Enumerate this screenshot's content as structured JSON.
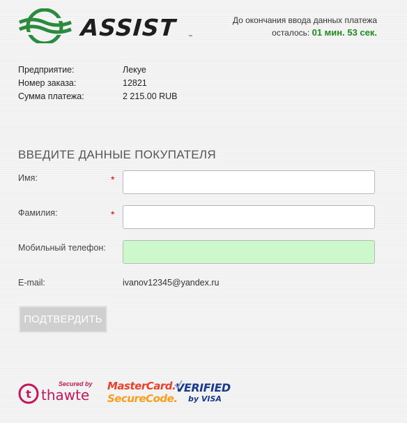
{
  "header": {
    "brand_name": "ASSIST",
    "trademark": "™",
    "timer_line1": "До окончания ввода данных платежа",
    "timer_prefix": "осталось:",
    "timer_value": "01 мин. 53 сек."
  },
  "order_info": [
    {
      "label": "Предприятие:",
      "value": "Лекуе"
    },
    {
      "label": "Номер заказа:",
      "value": "12821"
    },
    {
      "label": "Сумма платежа:",
      "value": "2 215.00 RUB"
    }
  ],
  "form": {
    "title": "ВВЕДИТЕ ДАННЫЕ ПОКУПАТЕЛЯ",
    "required_mark": "*",
    "fields": {
      "first_name": {
        "label": "Имя:",
        "value": ""
      },
      "last_name": {
        "label": "Фамилия:",
        "value": ""
      },
      "phone": {
        "label": "Мобильный телефон:",
        "value": ""
      },
      "email": {
        "label": "E-mail:",
        "value": "ivanov12345@yandex.ru"
      }
    },
    "submit_label": "ПОДТВЕРДИТЬ"
  },
  "badges": {
    "thawte_secured_by": "Secured by",
    "thawte_name": "thawte",
    "mastercard_line1": "MasterCard.",
    "mastercard_line2": "SecureCode.",
    "visa_line1": "VERIFIED",
    "visa_line2": "by VISA"
  },
  "colors": {
    "brand_green": "#2a8a3e",
    "timer_green": "#1e8a1e",
    "required_red": "#d00000",
    "phone_field_bg": "#ccf8cc",
    "button_bg": "#cfcfcf"
  }
}
